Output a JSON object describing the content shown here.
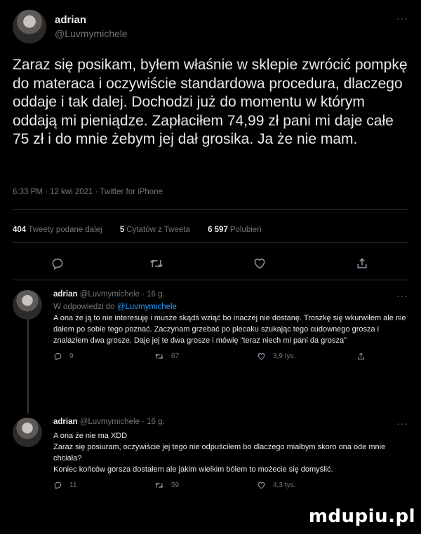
{
  "main_tweet": {
    "author_name": "adrian",
    "author_handle": "@Luvmymichele",
    "more_label": "···",
    "text": "Zaraz się posikam, byłem właśnie w sklepie zwrócić pompkę do materaca i oczywiście standardowa procedura, dlaczego oddaje i tak dalej. Dochodzi już do momentu w którym oddają mi pieniądze. Zapłaciłem 74,99 zł pani mi daje całe 75 zł i do mnie żebym jej dał grosika. Ja że nie mam.",
    "meta": "6:33 PM · 12 kwi 2021 · Twitter for iPhone",
    "stats": {
      "retweets_count": "404",
      "retweets_label": "Tweety podane dalej",
      "quotes_count": "5",
      "quotes_label": "Cytatów z Tweeta",
      "likes_count": "6 597",
      "likes_label": "Polubień"
    }
  },
  "replies": [
    {
      "author_name": "adrian",
      "author_handle": "@Luvmymichele · 16 g.",
      "more_label": "···",
      "reply_to_prefix": "W odpowiedzi do",
      "reply_to_handle": "@Luvmymichele",
      "text": "A ona że ją to nie interesuję i musze skądś wziąć bo inaczej nie dostanę. Troszkę się wkurwiłem ale nie dałem po sobie tego poznać. Zaczynam grzebać po plecaku szukając tego cudownego grosza i znalazłem dwa grosze. Daje jej te dwa grosze i mówię \"teraz niech mi pani da grosza\"",
      "replies_count": "9",
      "retweets_count": "67",
      "likes_count": "3,9 tys."
    },
    {
      "author_name": "adrian",
      "author_handle": "@Luvmymichele · 16 g.",
      "more_label": "···",
      "text": "A ona że nie ma XDD\nZaraz się posiuram, oczywiście jej tego nie odpuściłem bo dlaczego miałbym skoro ona ode mnie chciała?\nKoniec końców gorsza dostałem ale jakim wielkim bólem to możecie się domyślić.",
      "replies_count": "11",
      "retweets_count": "59",
      "likes_count": "4,3 tys."
    }
  ],
  "watermark": "mdupiu.pl",
  "colors": {
    "background": "#000000",
    "text": "#e7e9ea",
    "muted": "#71767b",
    "link": "#1d9bf0",
    "divider": "#2f3336"
  }
}
